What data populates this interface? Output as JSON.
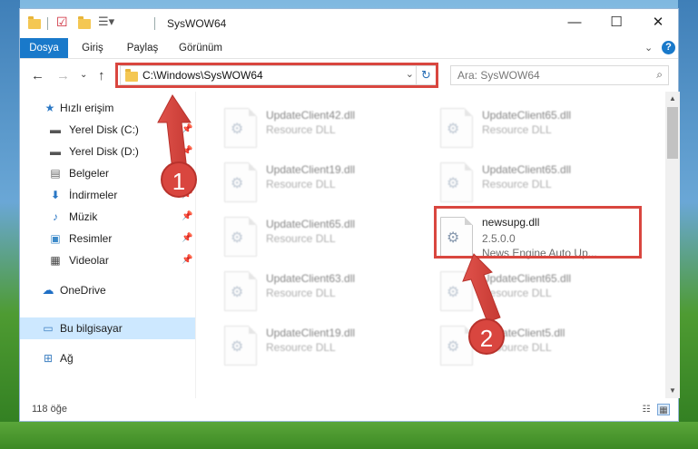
{
  "window": {
    "title": "SysWOW64",
    "controls": {
      "minimize": "—",
      "maximize": "☐",
      "close": "✕"
    }
  },
  "ribbon": {
    "tabs": [
      "Dosya",
      "Giriş",
      "Paylaş",
      "Görünüm"
    ]
  },
  "address_bar": {
    "path": "C:\\Windows\\SysWOW64",
    "search_placeholder": "Ara: SysWOW64"
  },
  "nav_pane": {
    "items": [
      {
        "label": "Hızlı erişim",
        "icon": "star-icon",
        "pinned": false
      },
      {
        "label": "Yerel Disk (C:)",
        "icon": "drive-icon",
        "pinned": true
      },
      {
        "label": "Yerel Disk (D:)",
        "icon": "drive-icon",
        "pinned": true
      },
      {
        "label": "Belgeler",
        "icon": "document-icon",
        "pinned": true
      },
      {
        "label": "İndirmeler",
        "icon": "download-icon",
        "pinned": true
      },
      {
        "label": "Müzik",
        "icon": "music-icon",
        "pinned": true
      },
      {
        "label": "Resimler",
        "icon": "pictures-icon",
        "pinned": true
      },
      {
        "label": "Videolar",
        "icon": "video-icon",
        "pinned": true
      },
      {
        "label": "OneDrive",
        "icon": "cloud-icon",
        "pinned": false
      },
      {
        "label": "Bu bilgisayar",
        "icon": "computer-icon",
        "pinned": false,
        "selected": true
      },
      {
        "label": "Ağ",
        "icon": "network-icon",
        "pinned": false
      }
    ]
  },
  "files": [
    {
      "name": "UpdateClient42.dll",
      "desc": "Resource DLL",
      "blurred": true
    },
    {
      "name": "UpdateClient65.dll",
      "desc": "Resource DLL",
      "blurred": true
    },
    {
      "name": "UpdateClient19.dll",
      "desc": "Resource DLL",
      "blurred": true
    },
    {
      "name": "UpdateClient65.dll",
      "desc": "Resource DLL",
      "blurred": true
    },
    {
      "name": "UpdateClient65.dll",
      "desc": "Resource DLL",
      "blurred": true
    },
    {
      "name": "newsupg.dll",
      "desc": "2.5.0.0",
      "desc2": "News Engine Auto Up...",
      "blurred": false
    },
    {
      "name": "UpdateClient63.dll",
      "desc": "Resource DLL",
      "blurred": true
    },
    {
      "name": "UpdateClient65.dll",
      "desc": "Resource DLL",
      "blurred": true
    },
    {
      "name": "UpdateClient19.dll",
      "desc": "Resource DLL",
      "blurred": true
    },
    {
      "name": "UpdateClient5.dll",
      "desc": "Resource DLL",
      "blurred": true
    }
  ],
  "status": {
    "item_count": "118 öğe"
  },
  "annotations": {
    "callout_1": "1",
    "callout_2": "2",
    "highlight_color": "#d9463f"
  }
}
